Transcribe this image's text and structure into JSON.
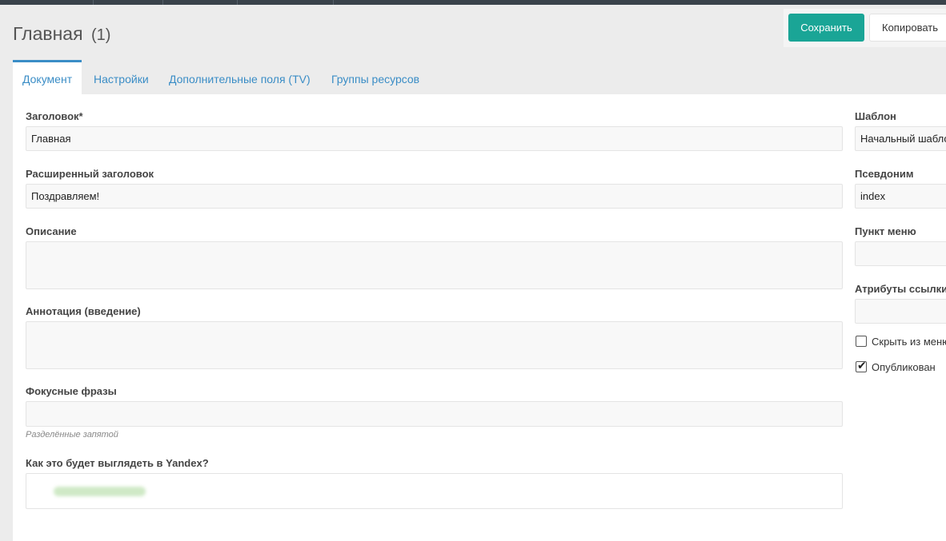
{
  "header": {
    "title": "Главная",
    "count": "(1)"
  },
  "actions": {
    "save_label": "Сохранить",
    "copy_label": "Копировать"
  },
  "tabs": [
    {
      "label": "Документ"
    },
    {
      "label": "Настройки"
    },
    {
      "label": "Дополнительные поля (TV)"
    },
    {
      "label": "Группы ресурсов"
    }
  ],
  "main": {
    "title_label": "Заголовок*",
    "title_value": "Главная",
    "longtitle_label": "Расширенный заголовок",
    "longtitle_value": "Поздравляем!",
    "description_label": "Описание",
    "description_value": "",
    "introtext_label": "Аннотация (введение)",
    "introtext_value": "",
    "keywords_label": "Фокусные фразы",
    "keywords_value": "",
    "keywords_hint": "Разделённые запятой",
    "yandex_label": "Как это будет выглядеть в Yandex?"
  },
  "side": {
    "template_label": "Шаблон",
    "template_value": "Начальный шаблон",
    "alias_label": "Псевдоним",
    "alias_value": "index",
    "menutitle_label": "Пункт меню",
    "menutitle_value": "",
    "link_attr_label": "Атрибуты ссылки",
    "link_attr_value": "",
    "hide_menu_label": "Скрыть из меню",
    "hide_menu_checked": false,
    "published_label": "Опубликован",
    "published_checked": true
  },
  "colors": {
    "accent": "#1aa596",
    "link": "#3a8dc6",
    "topbar": "#3a434b"
  }
}
